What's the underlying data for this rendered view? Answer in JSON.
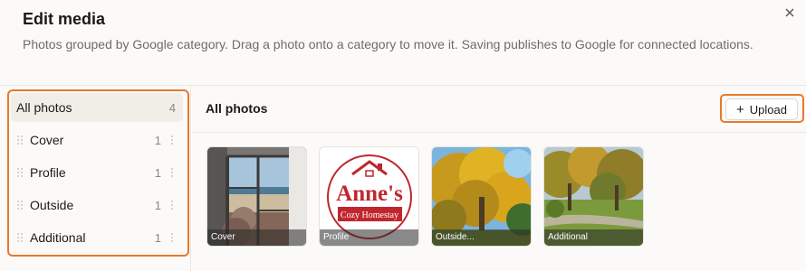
{
  "dialog": {
    "title": "Edit media",
    "description": "Photos grouped by Google category. Drag a photo onto a category to move it. Saving publishes to Google for connected locations.",
    "close_icon": "close-icon"
  },
  "sidebar": {
    "items": [
      {
        "label": "All photos",
        "count": "4"
      },
      {
        "label": "Cover",
        "count": "1"
      },
      {
        "label": "Profile",
        "count": "1"
      },
      {
        "label": "Outside",
        "count": "1"
      },
      {
        "label": "Additional",
        "count": "1"
      }
    ]
  },
  "main": {
    "title": "All photos",
    "upload_label": "Upload",
    "photos": [
      {
        "caption": "Cover"
      },
      {
        "caption": "Profile",
        "logo_line1": "Anne's",
        "logo_line2": "Cozy Homestay"
      },
      {
        "caption": "Outside..."
      },
      {
        "caption": "Additional"
      }
    ]
  },
  "colors": {
    "accent_outline": "#e8782c",
    "logo_red": "#c0262d"
  }
}
